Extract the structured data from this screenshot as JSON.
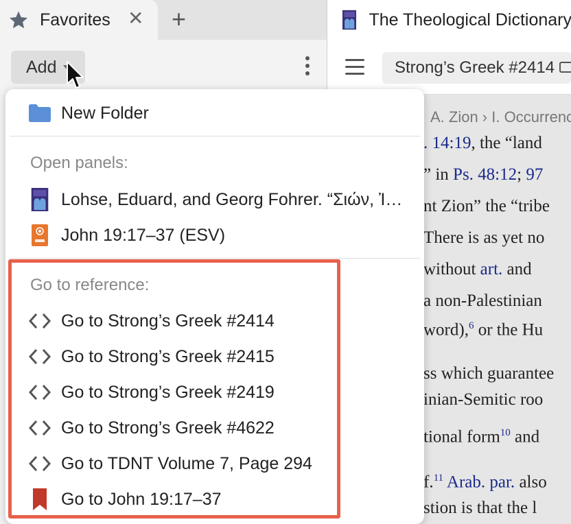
{
  "left_tab": {
    "label": "Favorites",
    "close_glyph": "✕",
    "add_glyph": "+"
  },
  "left_toolbar": {
    "add_label": "Add"
  },
  "right_tab": {
    "title": "The Theological Dictionary"
  },
  "right_toolbar": {
    "reference": "Strong’s Greek #2414"
  },
  "breadcrumb": "A. Zion › I. Occurrence",
  "doc_lines": {
    "l1a": ". 14:19",
    "l1b": ", the “land",
    "l2a": "” in ",
    "l2b": "Ps. 48:12",
    "l2c": "; ",
    "l2d": "97",
    "l3": "nt Zion” the “tribe",
    "l4": "There is as yet no",
    "l5a": " without ",
    "l5b": "art.",
    "l5c": " and",
    "l6": " a non-Palestinian",
    "l7a": "word),",
    "l7b": "6",
    "l7c": " or the Hu",
    "l8": "ss which guarantee",
    "l9": "inian-Semitic roo",
    "l10a": "tional form",
    "l10b": "10",
    "l10c": " and",
    "l11a": "f.",
    "l11b": "11",
    "l11c": " ",
    "l11d": "Arab. par.",
    "l11e": " also",
    "l12": "stion is that the l"
  },
  "dropdown": {
    "new_folder": "New Folder",
    "open_panels_header": "Open panels:",
    "open_panels": [
      {
        "label": "Lohse, Eduard, and Georg Fohrer. “Σιών, Ἰερουσαλήμ, Ἱεροσόλυμα",
        "icon": "book-icon"
      },
      {
        "label": "John 19:17–37 (ESV)",
        "icon": "esv-bible-icon"
      }
    ],
    "goto_header": "Go to reference:",
    "goto_items": [
      {
        "label": "Go to Strong’s Greek #2414",
        "icon": "code-brackets-icon"
      },
      {
        "label": "Go to Strong’s Greek #2415",
        "icon": "code-brackets-icon"
      },
      {
        "label": "Go to Strong’s Greek #2419",
        "icon": "code-brackets-icon"
      },
      {
        "label": "Go to Strong’s Greek #4622",
        "icon": "code-brackets-icon"
      },
      {
        "label": "Go to TDNT Volume 7, Page 294",
        "icon": "code-brackets-icon"
      },
      {
        "label": "Go to John 19:17–37",
        "icon": "bookmark-icon"
      }
    ]
  },
  "colors": {
    "highlight": "#e8604c",
    "folder": "#5b8fd8",
    "bookmark": "#c0392b",
    "esv": "#e8772e",
    "link": "#1a2a8c"
  }
}
